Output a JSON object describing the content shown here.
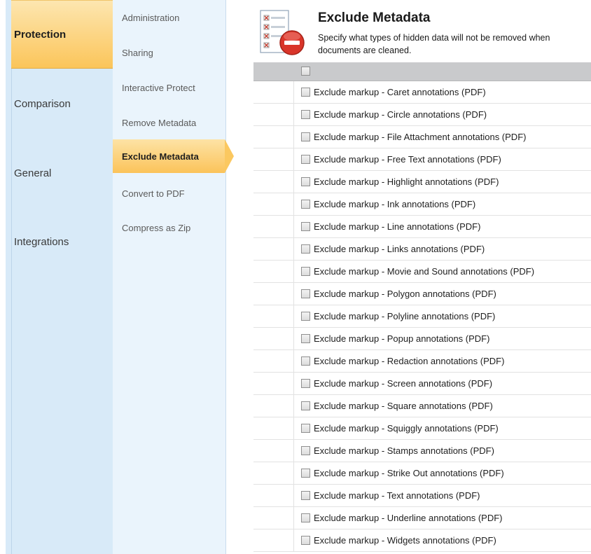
{
  "categories": [
    {
      "label": "Protection",
      "selected": true
    },
    {
      "label": "Comparison",
      "selected": false
    },
    {
      "label": "General",
      "selected": false
    },
    {
      "label": "Integrations",
      "selected": false
    }
  ],
  "subitems": [
    {
      "label": "Administration",
      "selected": false
    },
    {
      "label": "Sharing",
      "selected": false
    },
    {
      "label": "Interactive Protect",
      "selected": false
    },
    {
      "label": "Remove Metadata",
      "selected": false
    },
    {
      "label": "Exclude Metadata",
      "selected": true
    },
    {
      "label": "Convert to PDF",
      "selected": false
    },
    {
      "label": "Compress as Zip",
      "selected": false
    }
  ],
  "header": {
    "title": "Exclude Metadata",
    "description_line1": "Specify what types of hidden data will not be removed when",
    "description_line2": "documents are  cleaned."
  },
  "icons": {
    "header_icon": "document-checklist-remove-icon"
  },
  "colors": {
    "accent": "#fbc55a",
    "nav_bg": "#d8eaf8",
    "subnav_bg": "#eaf4fc",
    "grid_header": "#c9cacc"
  },
  "grid": {
    "select_all_checked": false,
    "rows": [
      {
        "label": "Exclude markup - Caret annotations (PDF)",
        "checked": false
      },
      {
        "label": "Exclude markup - Circle annotations (PDF)",
        "checked": false
      },
      {
        "label": "Exclude markup - File Attachment annotations (PDF)",
        "checked": false
      },
      {
        "label": "Exclude markup - Free Text annotations (PDF)",
        "checked": false
      },
      {
        "label": "Exclude markup - Highlight annotations (PDF)",
        "checked": false
      },
      {
        "label": "Exclude markup - Ink annotations (PDF)",
        "checked": false
      },
      {
        "label": "Exclude markup - Line annotations (PDF)",
        "checked": false
      },
      {
        "label": "Exclude markup - Links annotations (PDF)",
        "checked": false
      },
      {
        "label": "Exclude markup - Movie and Sound annotations (PDF)",
        "checked": false
      },
      {
        "label": "Exclude markup - Polygon annotations (PDF)",
        "checked": false
      },
      {
        "label": "Exclude markup - Polyline annotations (PDF)",
        "checked": false
      },
      {
        "label": "Exclude markup - Popup annotations (PDF)",
        "checked": false
      },
      {
        "label": "Exclude markup - Redaction annotations (PDF)",
        "checked": false
      },
      {
        "label": "Exclude markup - Screen annotations (PDF)",
        "checked": false
      },
      {
        "label": "Exclude markup - Square annotations (PDF)",
        "checked": false
      },
      {
        "label": "Exclude markup - Squiggly annotations (PDF)",
        "checked": false
      },
      {
        "label": "Exclude markup - Stamps annotations (PDF)",
        "checked": false
      },
      {
        "label": "Exclude markup - Strike Out annotations (PDF)",
        "checked": false
      },
      {
        "label": "Exclude markup - Text annotations (PDF)",
        "checked": false
      },
      {
        "label": "Exclude markup - Underline annotations (PDF)",
        "checked": false
      },
      {
        "label": "Exclude markup - Widgets annotations (PDF)",
        "checked": false
      }
    ]
  }
}
